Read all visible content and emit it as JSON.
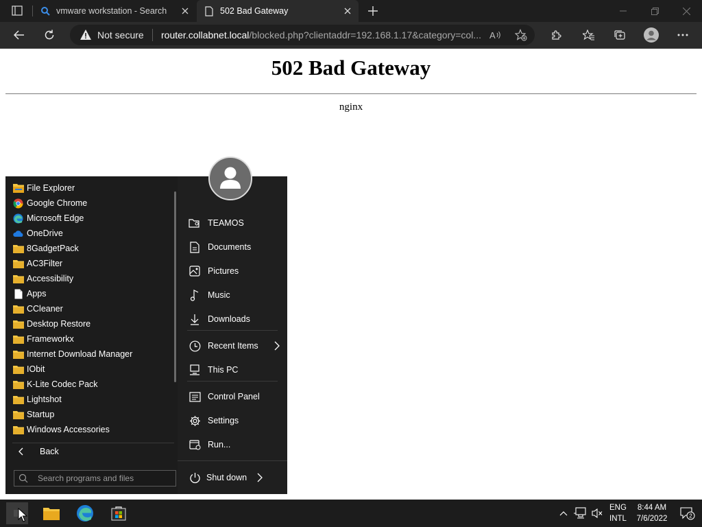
{
  "browser": {
    "tabs": [
      {
        "label": "vmware workstation - Search",
        "icon": "search-icon",
        "active": false
      },
      {
        "label": "502 Bad Gateway",
        "icon": "page-icon",
        "active": true
      }
    ],
    "address": {
      "security_label": "Not secure",
      "url_host": "router.collabnet.local",
      "url_rest": "/blocked.php?clientaddr=192.168.1.17&category=col..."
    }
  },
  "page": {
    "heading": "502 Bad Gateway",
    "server": "nginx"
  },
  "start_menu": {
    "programs": [
      {
        "label": "File Explorer",
        "icon": "file-explorer-icon"
      },
      {
        "label": "Google Chrome",
        "icon": "chrome-icon"
      },
      {
        "label": "Microsoft Edge",
        "icon": "edge-icon"
      },
      {
        "label": "OneDrive",
        "icon": "onedrive-icon"
      },
      {
        "label": "8GadgetPack",
        "icon": "folder-icon"
      },
      {
        "label": "AC3Filter",
        "icon": "folder-icon"
      },
      {
        "label": "Accessibility",
        "icon": "folder-icon"
      },
      {
        "label": "Apps",
        "icon": "document-icon"
      },
      {
        "label": "CCleaner",
        "icon": "folder-icon"
      },
      {
        "label": "Desktop Restore",
        "icon": "folder-icon"
      },
      {
        "label": "Frameworkx",
        "icon": "folder-icon"
      },
      {
        "label": "Internet Download Manager",
        "icon": "folder-icon"
      },
      {
        "label": "IObit",
        "icon": "folder-icon"
      },
      {
        "label": "K-Lite Codec Pack",
        "icon": "folder-icon"
      },
      {
        "label": "Lightshot",
        "icon": "folder-icon"
      },
      {
        "label": "Startup",
        "icon": "folder-icon"
      },
      {
        "label": "Windows Accessories",
        "icon": "folder-icon"
      }
    ],
    "back_label": "Back",
    "search_placeholder": "Search programs and files",
    "places": {
      "user": "TEAMOS",
      "documents": "Documents",
      "pictures": "Pictures",
      "music": "Music",
      "downloads": "Downloads",
      "recent": "Recent Items",
      "this_pc": "This PC",
      "control_panel": "Control Panel",
      "settings": "Settings",
      "run": "Run..."
    },
    "shutdown_label": "Shut down"
  },
  "taskbar": {
    "lang_line1": "ENG",
    "lang_line2": "INTL",
    "time": "8:44 AM",
    "date": "7/6/2022",
    "notification_count": "2"
  },
  "colors": {
    "folder": "#f4c542",
    "accent_blue": "#3b8eea"
  }
}
